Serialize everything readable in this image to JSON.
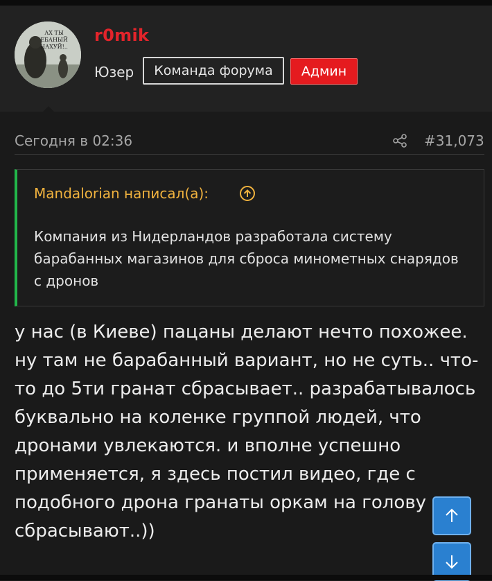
{
  "user": {
    "avatar_text": "АХ ТЫ\nЕБАНЫЙ\nНАХУЙ!..",
    "name": "r0mik",
    "title": "Юзер",
    "badges": [
      "Команда форума",
      "Админ"
    ]
  },
  "post": {
    "date": "Сегодня в 02:36",
    "number": "#31,073",
    "quote": {
      "author": "Mandalorian написал(а):",
      "text": "Компания из Нидерландов разработала систему барабанных магазинов для сброса минометных снарядов с дронов"
    },
    "body": "у нас (в Киеве) пацаны делают нечто похожее. ну там не барабанный вариант, но не суть.. что-то до 5ти гранат сбрасывает.. разрабатывалось буквально на коленке группой людей, что дронами увлекаются. и вполне успешно применяется, я здесь постил видео, где с подобного дрона гранаты оркам на голову сбрасывают..))"
  },
  "colors": {
    "username": "#e3242b",
    "admin_badge": "#e51b1f",
    "quote_bar": "#22b74a",
    "quote_author": "#f0b23e",
    "scroll_button": "#2a80d0"
  },
  "icons": [
    "share-icon",
    "arrow-up-circle-icon",
    "arrow-up-icon",
    "arrow-down-icon"
  ]
}
